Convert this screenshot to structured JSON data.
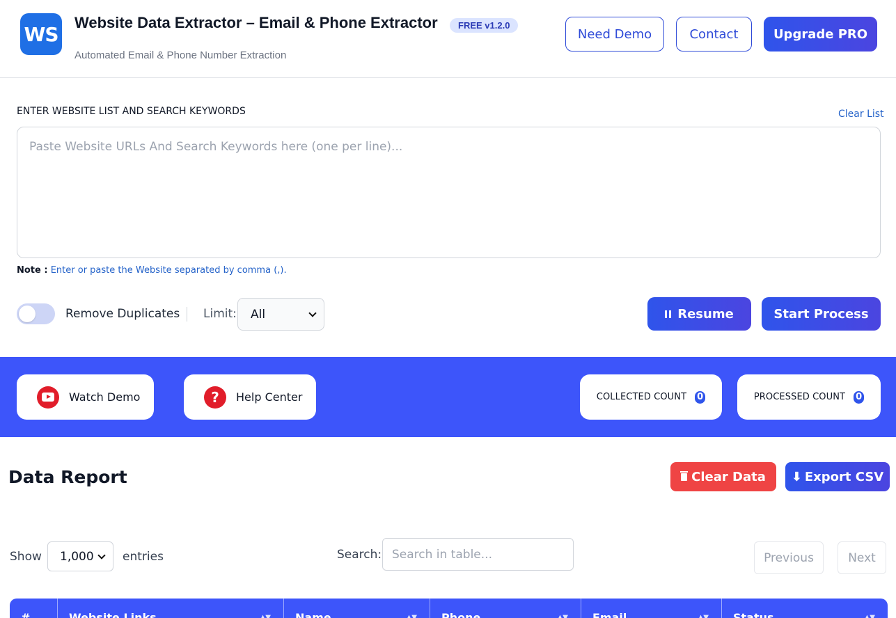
{
  "header": {
    "logo_text": "WS",
    "title": "Website Data Extractor – Email & Phone Extractor",
    "version_badge": "FREE v1.2.0",
    "subtitle": "Automated Email & Phone Number Extraction",
    "need_demo_label": "Need Demo",
    "contact_label": "Contact",
    "upgrade_label": "Upgrade PRO"
  },
  "input_section": {
    "label": "ENTER WEBSITE LIST AND SEARCH KEYWORDS",
    "clear_list_label": "Clear List",
    "placeholder": "Paste Website URLs And Search Keywords here (one per line)...",
    "note_prefix": "Note :",
    "note_text": "Enter or paste the Website separated by comma (,).",
    "remove_duplicates_label": "Remove Duplicates",
    "remove_duplicates_on": false,
    "limit_label": "Limit:",
    "limit_value": "All",
    "resume_label": "Resume",
    "start_label": "Start Process"
  },
  "toolbar_band": {
    "watch_demo_label": "Watch Demo",
    "help_center_label": "Help Center",
    "help_icon_glyph": "?",
    "collected_label": "COLLECTED COUNT",
    "collected_value": "0",
    "processed_label": "PROCESSED COUNT",
    "processed_value": "0"
  },
  "report": {
    "title": "Data Report",
    "clear_data_label": "Clear Data",
    "export_label": "Export CSV",
    "show_label": "Show",
    "entries_value": "1,000",
    "entries_label": "entries",
    "search_label": "Search:",
    "search_placeholder": "Search in table...",
    "previous_label": "Previous",
    "next_label": "Next",
    "columns": [
      "#",
      "Website Links",
      "Name",
      "Phone",
      "Email",
      "Status"
    ]
  },
  "colors": {
    "primary": "#3d55fa",
    "accent": "#2f54eb",
    "danger": "#ef4444",
    "logo": "#1f6fe5",
    "youtube": "#e11d2a"
  }
}
